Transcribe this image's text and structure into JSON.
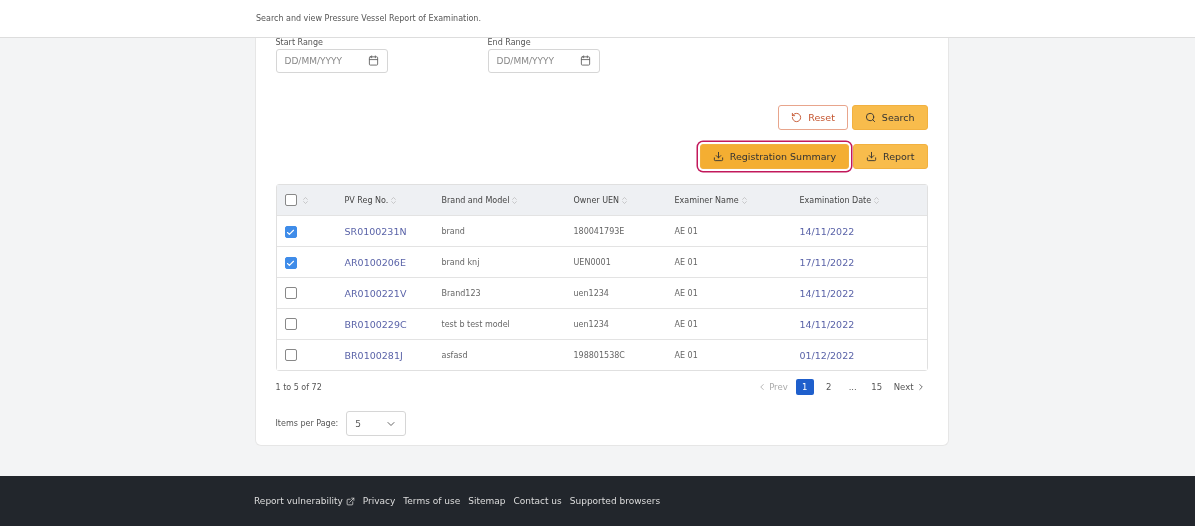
{
  "header": {
    "subtitle": "Search and view Pressure Vessel Report of Examination."
  },
  "date_fields": [
    {
      "label": "Start Range",
      "placeholder": "DD/MM/YYYY"
    },
    {
      "label": "End Range",
      "placeholder": "DD/MM/YYYY"
    }
  ],
  "action_buttons": [
    {
      "label": "Reset",
      "kind": "outline"
    },
    {
      "label": "Search",
      "kind": "search"
    }
  ],
  "export_buttons": [
    {
      "label": "Registration Summary",
      "selected": true
    },
    {
      "label": "Report",
      "selected": false
    }
  ],
  "table": {
    "select_all": {
      "checked": false
    },
    "columns": [
      "PV Reg No.",
      "Brand and Model",
      "Owner UEN",
      "Examiner Name",
      "Examination Date"
    ],
    "rows": [
      {
        "checked": true,
        "cells": [
          "SR0100231N",
          "brand",
          "180041793E",
          "AE 01",
          "14/11/2022"
        ]
      },
      {
        "checked": true,
        "cells": [
          "AR0100206E",
          "brand knj",
          "UEN0001",
          "AE 01",
          "17/11/2022"
        ]
      },
      {
        "checked": false,
        "cells": [
          "AR0100221V",
          "Brand123",
          "uen1234",
          "AE 01",
          "14/11/2022"
        ]
      },
      {
        "checked": false,
        "cells": [
          "BR0100229C",
          "test b test model",
          "uen1234",
          "AE 01",
          "14/11/2022"
        ]
      },
      {
        "checked": false,
        "cells": [
          "BR0100281J",
          "asfasd",
          "198801538C",
          "AE 01",
          "01/12/2022"
        ]
      }
    ]
  },
  "pagination": {
    "summary": "1 to 5 of 72",
    "prev": "Prev",
    "next": "Next",
    "pages": [
      {
        "label": "1",
        "selected": true
      },
      {
        "label": "2",
        "selected": false
      },
      {
        "label": "...",
        "selected": false
      },
      {
        "label": "15",
        "selected": false
      }
    ]
  },
  "items_per_page": {
    "label": "Items per Page:",
    "value": "5"
  },
  "footer": {
    "links": [
      {
        "label": "Report vulnerability",
        "external": true
      },
      {
        "label": "Privacy",
        "external": false
      },
      {
        "label": "Terms of use",
        "external": false
      },
      {
        "label": "Sitemap",
        "external": false
      },
      {
        "label": "Contact us",
        "external": false
      },
      {
        "label": "Supported browsers",
        "external": false
      }
    ]
  }
}
